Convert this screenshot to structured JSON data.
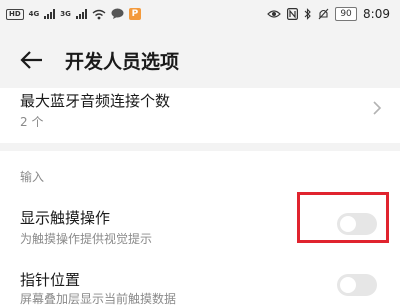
{
  "status_bar": {
    "hd_tag": "HD",
    "net1": "4G",
    "net2": "3G",
    "app_badge": "P",
    "battery": "90",
    "time": "8:09"
  },
  "header": {
    "title": "开发人员选项"
  },
  "settings": {
    "bluetooth_audio": {
      "title": "最大蓝牙音频连接个数",
      "value": "2 个"
    },
    "input_section": {
      "label": "输入"
    },
    "show_touches": {
      "title": "显示触摸操作",
      "subtitle": "为触摸操作提供视觉提示",
      "enabled": false
    },
    "pointer_location": {
      "title": "指针位置",
      "subtitle": "屏幕叠加层显示当前触摸数据",
      "enabled": false
    }
  },
  "colors": {
    "highlight": "#e0232e",
    "toggle_off": "#e6e6e6",
    "background_band": "#f3f3f3"
  },
  "icons": [
    "back-arrow-icon",
    "chevron-right-icon",
    "wifi-icon",
    "message-icon",
    "eye-icon",
    "nfc-icon",
    "bluetooth-icon",
    "mute-icon"
  ]
}
